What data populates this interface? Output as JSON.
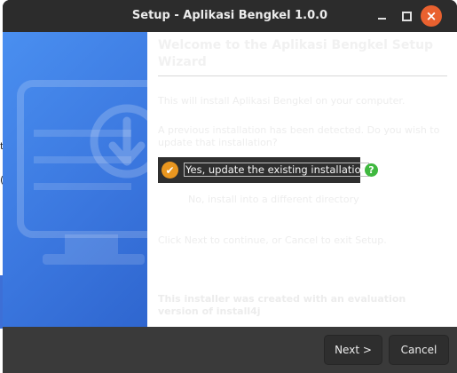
{
  "window": {
    "title": "Setup - Aplikasi Bengkel 1.0.0",
    "close_glyph": "×"
  },
  "desktop": {
    "glyph_1": "t",
    "glyph_2": "("
  },
  "wizard": {
    "heading": "Welcome to the Aplikasi Bengkel Setup Wizard",
    "intro": "This will install Aplikasi Bengkel on your computer.",
    "previous_install": "A previous installation has been detected. Do you wish to update that installation?",
    "option_update": "Yes, update the existing installation",
    "option_update_selected": true,
    "option_new_dir": "No, install into a different directory",
    "continue_text": "Click Next to continue, or Cancel to exit Setup.",
    "eval_notice": "This installer was created with an evaluation version of install4j",
    "help_glyph": "?",
    "check_glyph": "✔"
  },
  "buttons": {
    "next": "Next >",
    "cancel": "Cancel"
  },
  "colors": {
    "titlebar": "#2c2c2c",
    "close_accent": "#e9612f",
    "banner_blue": "#3a78e0",
    "check_orange": "#e9961f",
    "help_green": "#3fb83f"
  }
}
